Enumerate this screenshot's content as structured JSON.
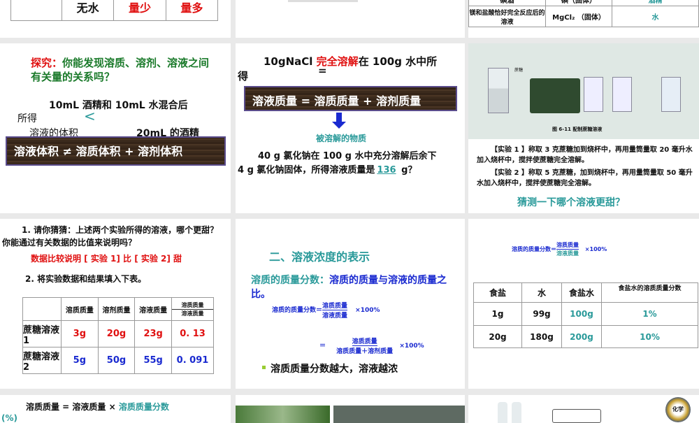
{
  "s_top_left": {
    "row": [
      "无水",
      "量少",
      "量多"
    ]
  },
  "s_top_right": {
    "row1": [
      "碘酒",
      "碘（固体）",
      "酒精"
    ],
    "row2": [
      "镁和盐酸恰好完全反应后的溶液",
      "MgCl₂ （固体）",
      "水"
    ]
  },
  "s_explore": {
    "label": "探究：",
    "question": "你能发现溶质、溶剂、溶液之间有关量的关系吗？",
    "line1": "10mL 酒精和 10mL 水混合后",
    "line2": "所得",
    "lt": "<",
    "line3": "溶液的体积",
    "line3b": "20mL 的酒精",
    "banner": "溶液体积 ≠  溶质体积 + 溶剂体积"
  },
  "s_nacl": {
    "line1a": "10gNaCl ",
    "line1b": "完全溶解",
    "line1c": "在 100g 水中所",
    "line2": "得",
    "eq": "=",
    "banner": "溶液质量 = 溶质质量 + 溶剂质量",
    "arrow_label": "被溶解的物质",
    "q1": "40 g 氯化钠在 100 g 水中充分溶解后余下",
    "q2": "4 g 氯化钠固体，所得溶液质量是",
    "answer": "136",
    "unit": " g？"
  },
  "s_exp": {
    "caption": "图 6-11 配制蔗糖溶液",
    "jar_label": "蔗糖",
    "p1": "【实验 1 】称取 3 克蔗糖加到烧杯中，再用量筒量取 20 毫升水加入烧杯中，搅拌使蔗糖完全溶解。",
    "p2": "【实验 2 】称取 5 克蔗糖，加到烧杯中，再用量筒量取 50 毫升水加入烧杯中，搅拌使蔗糖完全溶解。",
    "guess": "猜测一下哪个溶液更甜？"
  },
  "s_compare": {
    "q1": "1. 请你猜猜：上述两个实验所得的溶液，哪个更甜？你能通过有关数据的比值来说明吗？",
    "answer": "数据比较说明 [ 实验 1] 比 [ 实验 2] 甜",
    "q2": "2. 将实验数据和结果填入下表。",
    "headers": [
      "",
      "溶质质量",
      "溶剂质量",
      "溶液质量"
    ],
    "ratio_top": "溶质质量",
    "ratio_bottom": "溶液质量",
    "rows": [
      [
        "蔗糖溶液 1",
        "3g",
        "20g",
        "23g",
        "0. 13"
      ],
      [
        "蔗糖溶液 2",
        "5g",
        "50g",
        "55g",
        "0. 091"
      ]
    ]
  },
  "s_conc": {
    "title": "二、溶液浓度的表示",
    "def_a": "溶质的质量分数：",
    "def_b": "溶质的质量与溶液的质量之比。",
    "f_left": "溶质的质量分数＝",
    "f_top": "溶质质量",
    "f_bottom": "溶液质量",
    "f_mul": "×100%",
    "f2_eq": "＝",
    "f2_top": "溶质质量",
    "f2_bottom": "溶质质量＋溶剂质量",
    "bullet": "溶质质量分数越大，溶液越浓"
  },
  "s_salt": {
    "f_left": "溶质的质量分数＝",
    "f_top": "溶质质量",
    "f_bottom": "溶液质量",
    "f_mul": "×100%",
    "headers": [
      "食盐",
      "水",
      "食盐水",
      "食盐水的溶质质量分数"
    ],
    "rows": [
      [
        "1g",
        "99g",
        "100g",
        "1%"
      ],
      [
        "20g",
        "180g",
        "200g",
        "10%"
      ]
    ]
  },
  "s_bottom_left": {
    "a": "溶质质量 = 溶液质量 × ",
    "b": "溶质质量分数",
    "c": "(%)"
  },
  "s_bottom_right": {
    "logo": "化学"
  }
}
